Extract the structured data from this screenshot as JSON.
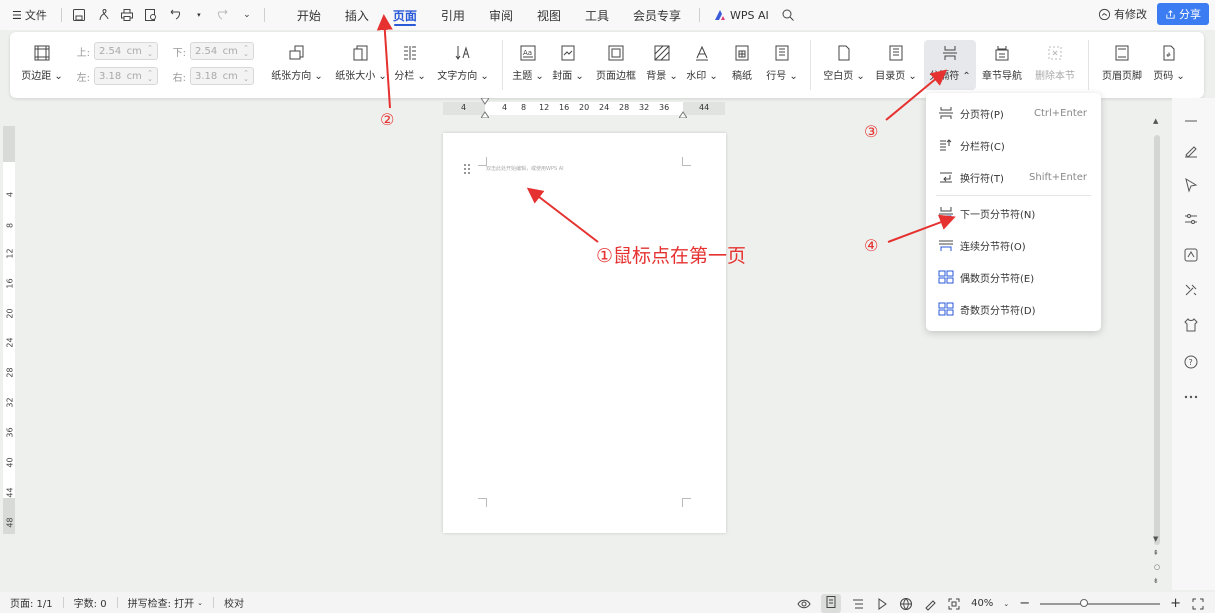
{
  "menubar": {
    "file_label": "文件",
    "tabs": [
      {
        "label": "开始",
        "active": false
      },
      {
        "label": "插入",
        "active": false
      },
      {
        "label": "页面",
        "active": true
      },
      {
        "label": "引用",
        "active": false
      },
      {
        "label": "审阅",
        "active": false
      },
      {
        "label": "视图",
        "active": false
      },
      {
        "label": "工具",
        "active": false
      },
      {
        "label": "会员专享",
        "active": false
      }
    ],
    "wps_ai": "WPS AI",
    "modify_label": "有修改",
    "share_label": "分享"
  },
  "ribbon": {
    "page_margin": "页边距",
    "margin_top_label": "上:",
    "margin_top_value": "2.54",
    "margin_bottom_label": "下:",
    "margin_bottom_value": "2.54",
    "margin_left_label": "左:",
    "margin_left_value": "3.18",
    "margin_right_label": "右:",
    "margin_right_value": "3.18",
    "unit": "cm",
    "orientation": "纸张方向",
    "paper_size": "纸张大小",
    "columns": "分栏",
    "text_direction": "文字方向",
    "theme": "主题",
    "cover": "封面",
    "page_border": "页面边框",
    "background": "背景",
    "watermark": "水印",
    "manuscript": "稿纸",
    "line_number": "行号",
    "blank_page": "空白页",
    "toc_page": "目录页",
    "separator": "分隔符",
    "section_nav": "章节导航",
    "delete_section": "删除本节",
    "header_footer": "页眉页脚",
    "page_number": "页码"
  },
  "ruler": {
    "h_ticks": [
      "4",
      "4",
      "8",
      "12",
      "16",
      "20",
      "24",
      "28",
      "32",
      "36",
      "44"
    ],
    "v_ticks": [
      "4",
      "8",
      "12",
      "16",
      "20",
      "24",
      "28",
      "32",
      "36",
      "40",
      "44",
      "48"
    ]
  },
  "page": {
    "hint_text": "双击此处开始编辑，或使用WPS AI"
  },
  "dropdown": {
    "items": [
      {
        "label": "分页符(P)",
        "shortcut": "Ctrl+Enter"
      },
      {
        "label": "分栏符(C)",
        "shortcut": ""
      },
      {
        "label": "换行符(T)",
        "shortcut": "Shift+Enter"
      },
      {
        "label": "下一页分节符(N)",
        "shortcut": ""
      },
      {
        "label": "连续分节符(O)",
        "shortcut": ""
      },
      {
        "label": "偶数页分节符(E)",
        "shortcut": ""
      },
      {
        "label": "奇数页分节符(D)",
        "shortcut": ""
      }
    ]
  },
  "annotations": {
    "n1_text": "①鼠标点在第一页",
    "n2": "②",
    "n3": "③",
    "n4": "④",
    "color": "#e53230"
  },
  "statusbar": {
    "page": "页面: 1/1",
    "words": "字数: 0",
    "spell": "拼写检查: 打开",
    "proof": "校对",
    "zoom": "40%"
  },
  "colors": {
    "accent": "#2a5ad7",
    "share_bg": "#3b7cf2"
  }
}
